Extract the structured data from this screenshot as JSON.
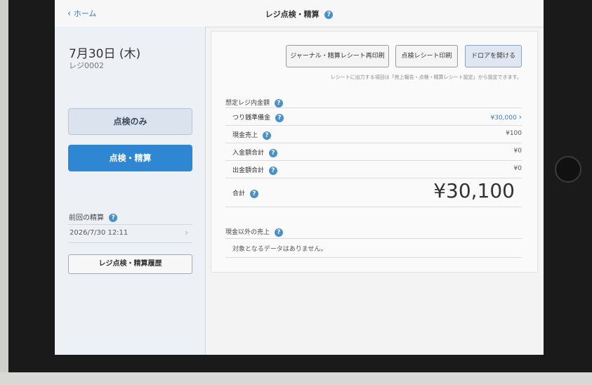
{
  "header": {
    "back_label": "ホーム",
    "title": "レジ点検・精算",
    "help": "?"
  },
  "left": {
    "date": "7月30日 (木)",
    "register": "レジ0002",
    "check_only_label": "点検のみ",
    "check_settle_label": "点検・精算",
    "previous_label": "前回の精算",
    "previous_date": "2026/7/30 12:11",
    "history_label": "レジ点検・精算履歴"
  },
  "toolbar": {
    "journal_reprint": "ジャーナル・精算レシート再印刷",
    "print_receipt": "点検レシート印刷",
    "open_drawer": "ドロアを開ける"
  },
  "note": "レシートに出力する項目は「売上報告・点検・精算レシート設定」から設定できます。",
  "cash": {
    "section_label": "想定レジ内金額",
    "rows": [
      {
        "label": "つり銭準備金",
        "value": "¥30,000"
      },
      {
        "label": "現金売上",
        "value": "¥100"
      },
      {
        "label": "入金額合計",
        "value": "¥0"
      },
      {
        "label": "出金額合計",
        "value": "¥0"
      }
    ],
    "total_label": "合計",
    "total_value": "¥30,100"
  },
  "non_cash": {
    "section_label": "現金以外の売上",
    "empty_text": "対象となるデータはありません。"
  },
  "icons": {
    "back": "chevron-left-icon",
    "help": "help-icon",
    "chevron": "chevron-right-icon"
  },
  "colors": {
    "accent": "#2f86d2",
    "link": "#3d7bc6",
    "help_icon": "#4a90c9"
  }
}
